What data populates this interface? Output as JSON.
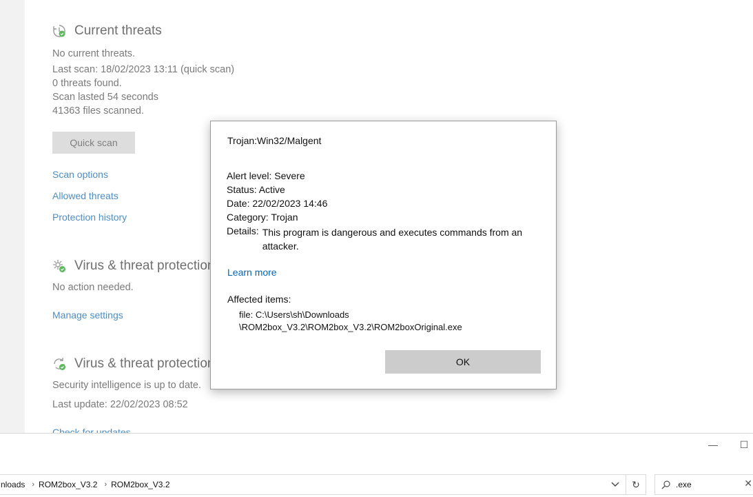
{
  "security": {
    "current_threats": {
      "heading": "Current threats",
      "lines": [
        "No current threats.",
        "Last scan: 18/02/2023 13:11 (quick scan)",
        "0 threats found.",
        "Scan lasted 54 seconds",
        "41363 files scanned."
      ],
      "quick_scan": "Quick scan",
      "links": [
        "Scan options",
        "Allowed threats",
        "Protection history"
      ]
    },
    "settings": {
      "heading": "Virus & threat protection settings",
      "status": "No action needed.",
      "link": "Manage settings"
    },
    "updates": {
      "heading": "Virus & threat protection updates",
      "status": "Security intelligence is up to date.",
      "last_update": "Last update: 22/02/2023 08:52",
      "link": "Check for updates"
    }
  },
  "dialog": {
    "title": "Trojan:Win32/Malgent",
    "alert_level": "Alert level: Severe",
    "status_key": "Status:",
    "status_val": "Active",
    "date_key": "Date:",
    "date_val": "22/02/2023 14:46",
    "category_key": "Category:",
    "category_val": "Trojan",
    "details_key": "Details:",
    "details_val": "This program is dangerous and executes commands from an attacker.",
    "learn_more": "Learn more",
    "affected_label": "Affected items:",
    "file_line1": "file: C:\\Users\\sh\\Downloads",
    "file_line2": "\\ROM2box_V3.2\\ROM2box_V3.2\\ROM2boxOriginal.exe",
    "ok": "OK"
  },
  "explorer": {
    "breadcrumbs": [
      "nloads",
      "ROM2box_V3.2",
      "ROM2box_V3.2"
    ],
    "search_value": ".exe",
    "minimize": "—",
    "maximize": "☐"
  },
  "colors": {
    "link": "#0067b8",
    "muted_link": "#4d8dc4",
    "ok_button": "#cccccc"
  }
}
